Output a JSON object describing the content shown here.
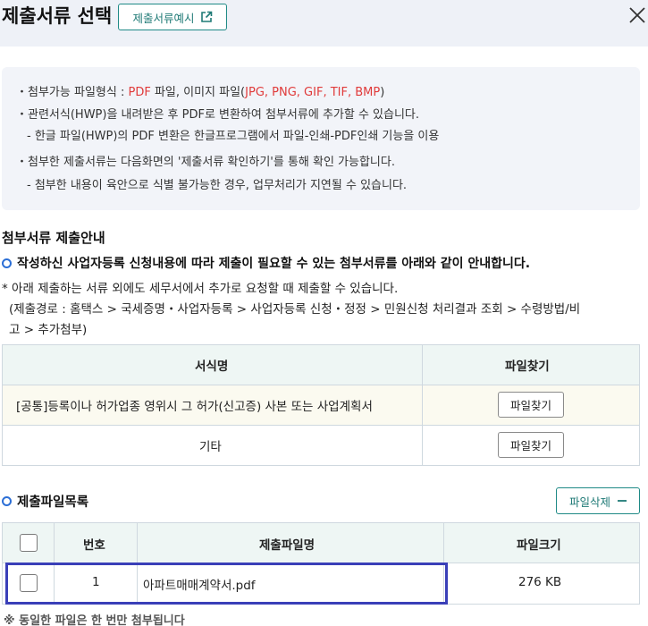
{
  "header": {
    "title": "제출서류 선택",
    "example_button": "제출서류예시"
  },
  "info": {
    "formats_prefix": "첨부가능 파일형식 : ",
    "formats_pdf": "PDF",
    "formats_mid": " 파일, 이미지 파일(",
    "formats_images": "JPG, PNG, GIF, TIF, BMP",
    "formats_suffix": ")",
    "hwp_line": "관련서식(HWP)을 내려받은 후 PDF로 변환하여 첨부서류에 추가할 수 있습니다.",
    "hwp_sub": "한글 파일(HWP)의 PDF 변환은 한글프로그램에서 파일-인쇄-PDF인쇄 기능을 이용",
    "confirm_line": "첨부한 제출서류는 다음화면의 '제출서류 확인하기'를 통해 확인 가능합니다.",
    "confirm_sub": "- 첨부한 내용이 육안으로 식별 불가능한 경우, 업무처리가 지연될 수 있습니다."
  },
  "guide": {
    "section_title": "첨부서류 제출안내",
    "bold_line": "작성하신 사업자등록 신청내용에 따라 제출이 필요할 수 있는 첨부서류를 아래와 같이 안내합니다.",
    "note_line1": "* 아래 제출하는 서류 외에도 세무서에서 추가로 요청할 때 제출할 수 있습니다.",
    "note_line2": "(제출경로 : 홈택스 > 국세증명・사업자등록 > 사업자등록 신청・정정 > 민원신청 처리결과 조회 > 수령방법/비",
    "note_line3": "고 > 추가첨부)"
  },
  "doc_table": {
    "headers": [
      "서식명",
      "파일찾기"
    ],
    "rows": [
      {
        "name": "[공통]등록이나 허가업종 영위시 그 허가(신고증) 사본 또는 사업계획서",
        "button": "파일찾기"
      },
      {
        "name": "기타",
        "button": "파일찾기"
      }
    ]
  },
  "file_list": {
    "title": "제출파일목록",
    "delete_button": "파일삭제",
    "headers": [
      "번호",
      "제출파일명",
      "파일크기"
    ],
    "rows": [
      {
        "number": "1",
        "filename": "아파트매매계약서.pdf",
        "size": "276 KB"
      }
    ],
    "footnote": "※ 동일한 파일은 한 번만 첨부됩니다"
  },
  "colors": {
    "accent_teal": "#1f8a86",
    "highlight_red": "#e03a3a",
    "ring_blue": "#2c6fd6",
    "selection_box": "#3a3fb8"
  },
  "icons": [
    "external-link-icon",
    "close-icon",
    "minus-icon"
  ]
}
